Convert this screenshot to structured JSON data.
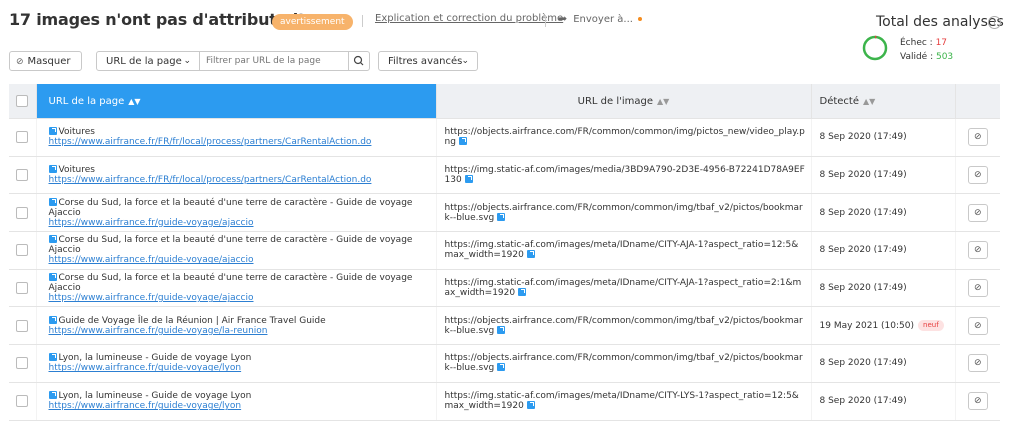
{
  "header": {
    "title": "17 images n'ont pas d'attribut alt",
    "badge": "avertissement",
    "help_link": "Explication et correction du problème",
    "send_label": "Envoyer à..."
  },
  "summary": {
    "title": "Total des analyses",
    "fail_label": "Échec : ",
    "fail_value": "17",
    "ok_label": "Validé : ",
    "ok_value": "503",
    "accent_fail": "#e63e3e",
    "accent_ok": "#3cb44b"
  },
  "toolbar": {
    "hide_label": "Masquer",
    "url_select": "URL de la page",
    "filter_placeholder": "Filtrer par URL de la page",
    "advanced_label": "Filtres avancés"
  },
  "table": {
    "headers": [
      "URL de la page",
      "URL de l'image",
      "Détecté"
    ],
    "rows": [
      {
        "title": "Voitures",
        "url": "https://www.airfrance.fr/FR/fr/local/process/partners/CarRentalAction.do",
        "image": "https://objects.airfrance.com/FR/common/common/img/pictos_new/video_play.png",
        "date": "8 Sep 2020 (17:49)",
        "new": ""
      },
      {
        "title": "Voitures",
        "url": "https://www.airfrance.fr/FR/fr/local/process/partners/CarRentalAction.do",
        "image": "https://img.static-af.com/images/media/3BD9A790-2D3E-4956-B72241D78A9EF130",
        "date": "8 Sep 2020 (17:49)",
        "new": ""
      },
      {
        "title": "Corse du Sud, la force et la beauté d'une terre de caractère - Guide de voyage Ajaccio",
        "url": "https://www.airfrance.fr/guide-voyage/ajaccio",
        "image": "https://objects.airfrance.com/FR/common/common/img/tbaf_v2/pictos/bookmark--blue.svg",
        "date": "8 Sep 2020 (17:49)",
        "new": ""
      },
      {
        "title": "Corse du Sud, la force et la beauté d'une terre de caractère - Guide de voyage Ajaccio",
        "url": "https://www.airfrance.fr/guide-voyage/ajaccio",
        "image": "https://img.static-af.com/images/meta/IDname/CITY-AJA-1?aspect_ratio=12:5&max_width=1920",
        "date": "8 Sep 2020 (17:49)",
        "new": ""
      },
      {
        "title": "Corse du Sud, la force et la beauté d'une terre de caractère - Guide de voyage Ajaccio",
        "url": "https://www.airfrance.fr/guide-voyage/ajaccio",
        "image": "https://img.static-af.com/images/meta/IDname/CITY-AJA-1?aspect_ratio=2:1&max_width=1920",
        "date": "8 Sep 2020 (17:49)",
        "new": ""
      },
      {
        "title": "Guide de Voyage Île de la Réunion | Air France Travel Guide",
        "url": "https://www.airfrance.fr/guide-voyage/la-reunion",
        "image": "https://objects.airfrance.com/FR/common/common/img/tbaf_v2/pictos/bookmark--blue.svg",
        "date": "19 May 2021 (10:50)",
        "new": "neuf"
      },
      {
        "title": "Lyon, la lumineuse - Guide de voyage Lyon",
        "url": "https://www.airfrance.fr/guide-voyage/lyon",
        "image": "https://objects.airfrance.com/FR/common/common/img/tbaf_v2/pictos/bookmark--blue.svg",
        "date": "8 Sep 2020 (17:49)",
        "new": ""
      },
      {
        "title": "Lyon, la lumineuse - Guide de voyage Lyon",
        "url": "https://www.airfrance.fr/guide-voyage/lyon",
        "image": "https://img.static-af.com/images/meta/IDname/CITY-LYS-1?aspect_ratio=12:5&max_width=1920",
        "date": "8 Sep 2020 (17:49)",
        "new": ""
      }
    ]
  }
}
